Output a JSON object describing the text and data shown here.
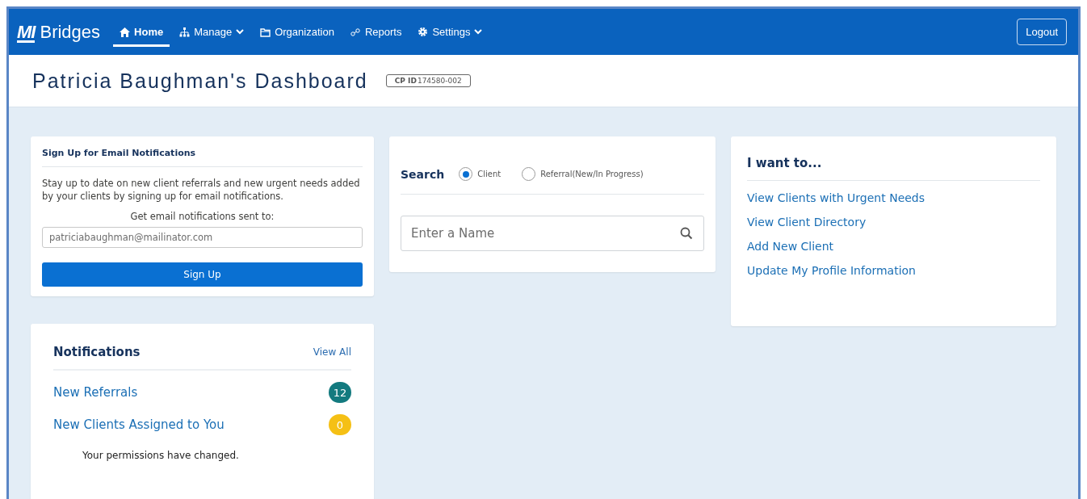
{
  "header": {
    "logo_mark": "MI",
    "brand": "Bridges",
    "nav": [
      {
        "label": "Home",
        "kind": "home",
        "selected": true,
        "dropdown": false
      },
      {
        "label": "Manage",
        "kind": "hierarchy",
        "selected": false,
        "dropdown": true
      },
      {
        "label": "Organization",
        "kind": "folder",
        "selected": false,
        "dropdown": false
      },
      {
        "label": "Reports",
        "kind": "reports",
        "selected": false,
        "dropdown": false
      },
      {
        "label": "Settings",
        "kind": "gear",
        "selected": false,
        "dropdown": true
      }
    ],
    "logout": "Logout"
  },
  "page": {
    "title": "Patricia Baughman's Dashboard",
    "id_label": "CP ID",
    "id_value": "174580-002"
  },
  "email_card": {
    "title": "Sign Up for Email Notifications",
    "text": "Stay up to date on new client referrals and new urgent needs added by your clients by signing up for email notifications.",
    "field_label": "Get email notifications sent to:",
    "field_value": "patriciabaughman@mailinator.com",
    "button": "Sign Up"
  },
  "notifications": {
    "title": "Notifications",
    "view_all": "View All",
    "items": [
      {
        "label": "New Referrals",
        "count": "12",
        "color": "#137a7f"
      },
      {
        "label": "New Clients Assigned to You",
        "count": "0",
        "color": "#f5c015"
      }
    ],
    "message": "Your permissions have changed."
  },
  "search": {
    "label": "Search",
    "options": [
      {
        "label": "Client",
        "selected": true
      },
      {
        "label": "Referral(New/In Progress)",
        "selected": false
      }
    ],
    "placeholder": "Enter a Name"
  },
  "actions": {
    "title": "I want to...",
    "links": [
      "View Clients with Urgent Needs",
      "View Client Directory",
      "Add New Client",
      "Update My Profile Information"
    ]
  }
}
